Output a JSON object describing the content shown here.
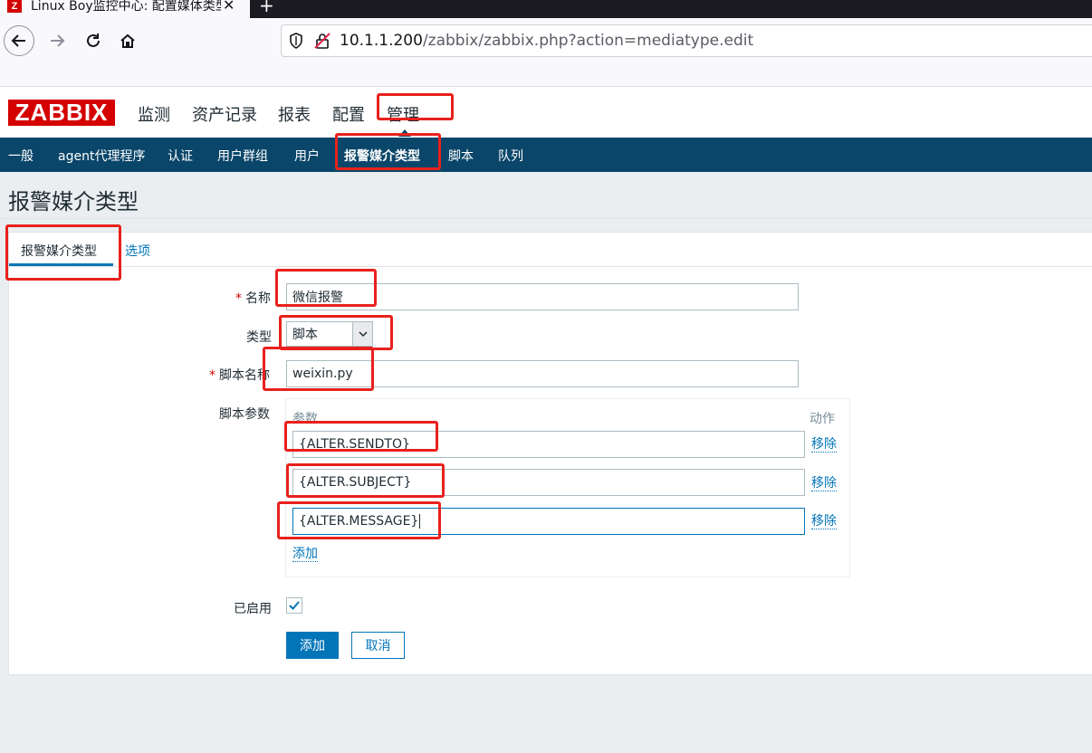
{
  "browser": {
    "tab_title": "Linux Boy监控中心: 配置媒体类型",
    "favicon_letter": "Z",
    "url_host": "10.1.1.200",
    "url_path": "/zabbix/zabbix.php?action=mediatype.edit"
  },
  "header": {
    "logo": "ZABBIX",
    "main_menu": [
      "监测",
      "资产记录",
      "报表",
      "配置",
      "管理"
    ],
    "active_main": "管理"
  },
  "submenu": {
    "items": [
      "一般",
      "agent代理程序",
      "认证",
      "用户群组",
      "用户",
      "报警媒介类型",
      "脚本",
      "队列"
    ],
    "active": "报警媒介类型"
  },
  "page": {
    "title": "报警媒介类型"
  },
  "tabs": [
    "报警媒介类型",
    "选项"
  ],
  "form": {
    "name_label": "名称",
    "name_value": "微信报警",
    "type_label": "类型",
    "type_value": "脚本",
    "script_name_label": "脚本名称",
    "script_name_value": "weixin.py",
    "script_params_label": "脚本参数",
    "params_col": "参数",
    "action_col": "动作",
    "params": [
      "{ALTER.SENDTO}",
      "{ALTER.SUBJECT}",
      "{ALTER.MESSAGE}"
    ],
    "remove_label": "移除",
    "add_link": "添加",
    "enabled_label": "已启用",
    "enabled": true,
    "required_mark": "*",
    "add_button": "添加",
    "cancel_button": "取消"
  },
  "colors": {
    "brand_red": "#d40000",
    "nav_blue": "#0a466a",
    "link_blue": "#0275b8",
    "highlight_red": "#e8211d"
  }
}
